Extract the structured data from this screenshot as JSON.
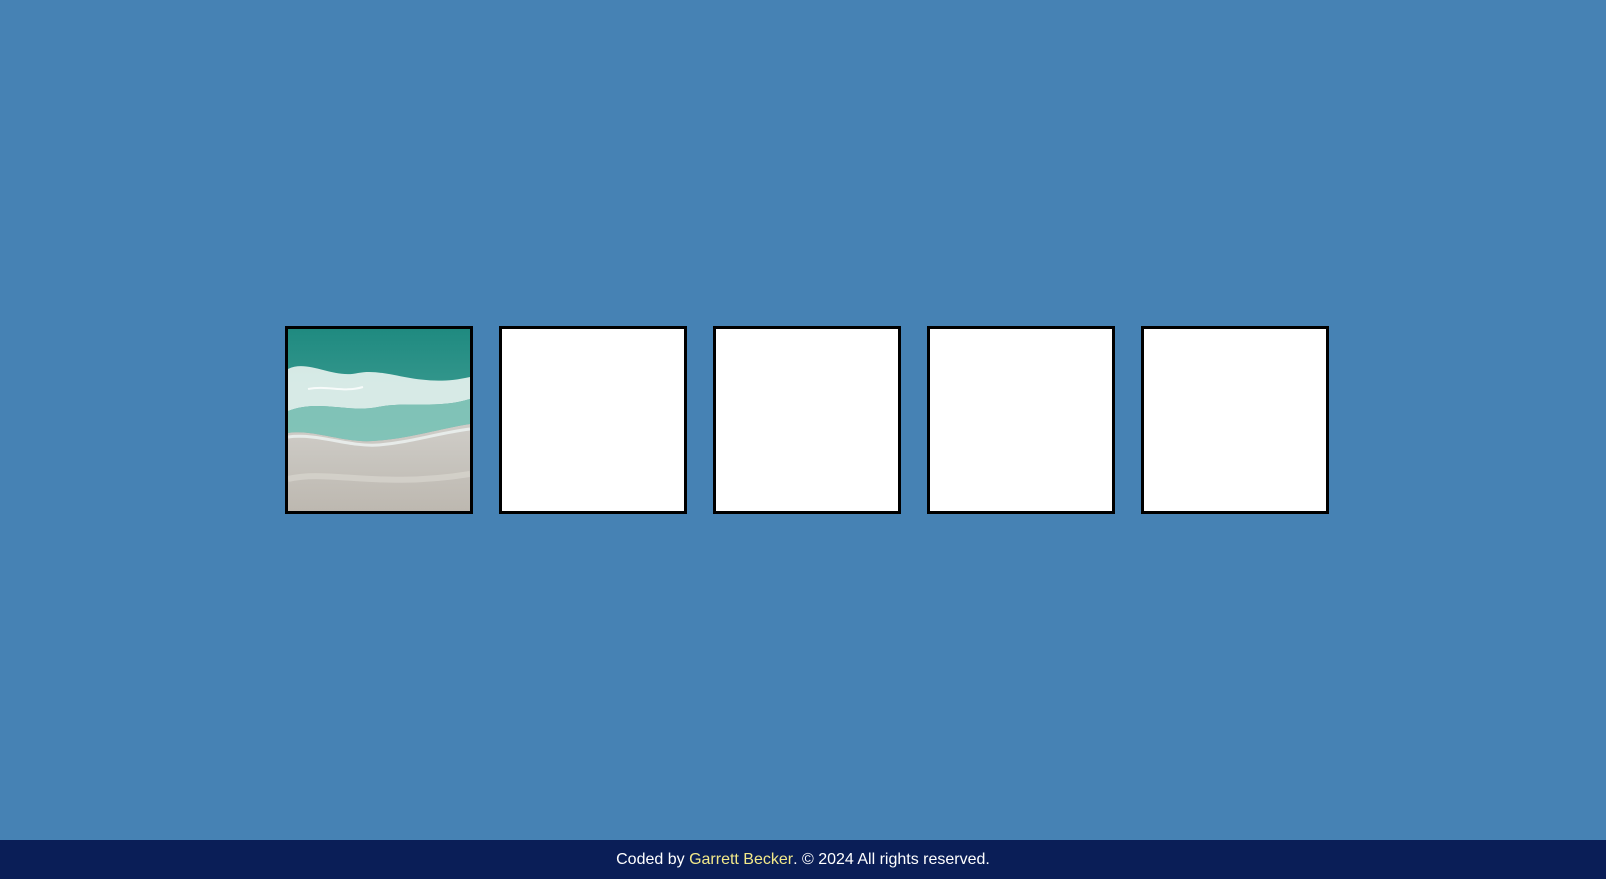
{
  "boxes": [
    {
      "content": "beach-image",
      "filled": true
    },
    {
      "content": "empty",
      "filled": false
    },
    {
      "content": "empty",
      "filled": false
    },
    {
      "content": "empty",
      "filled": false
    },
    {
      "content": "empty",
      "filled": false
    }
  ],
  "footer": {
    "prefix": "Coded by ",
    "author": "Garrett Becker",
    "suffix": ". © 2024 All rights reserved."
  },
  "colors": {
    "background": "#4682b4",
    "footer_background": "#0a1e57",
    "author_link": "#f3e98a",
    "box_border": "#000000",
    "box_fill": "#ffffff"
  }
}
